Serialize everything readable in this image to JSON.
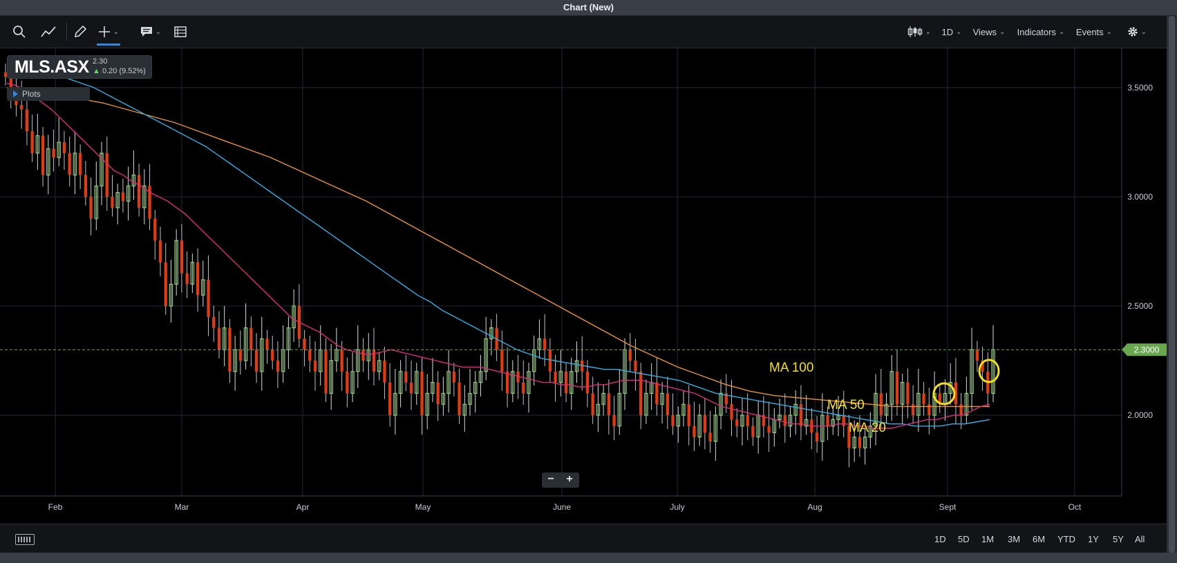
{
  "window": {
    "title": "Chart (New)"
  },
  "toolbar": {
    "interval": "1D",
    "views": "Views",
    "indicators": "Indicators",
    "events": "Events"
  },
  "symbol": {
    "name": "MLS.ASX",
    "price": "2.30",
    "change": "0.20 (9.52%)"
  },
  "plots_label": "Plots",
  "bottom_ranges": [
    "1D",
    "5D",
    "1M",
    "3M",
    "6M",
    "YTD",
    "1Y",
    "5Y",
    "All"
  ],
  "colors": {
    "up": "#8cd66a",
    "down": "#e23b12",
    "ma20": "#e0287f",
    "ma50": "#2bb0e8",
    "ma100": "#f0922c",
    "annotation": "#f5e11a",
    "last_price": "#6aa84f"
  },
  "chart_data": {
    "type": "candlestick",
    "x_ticks": [
      "Feb",
      "Mar",
      "Apr",
      "May",
      "June",
      "July",
      "Aug",
      "Sept",
      "Oct"
    ],
    "y_ticks": [
      "3.5000",
      "3.0000",
      "2.5000",
      "2.0000"
    ],
    "ylim": [
      1.63,
      3.68
    ],
    "last_price_label": "2.3000",
    "last_price": 2.3,
    "grid": true,
    "annotations": [
      "MA 100",
      "MA 50",
      "MA 20"
    ],
    "closes": [
      3.55,
      3.48,
      3.42,
      3.4,
      3.3,
      3.2,
      3.28,
      3.1,
      3.22,
      3.18,
      3.25,
      3.2,
      3.1,
      3.2,
      3.1,
      3.0,
      2.9,
      3.05,
      3.2,
      3.0,
      2.95,
      3.02,
      2.98,
      3.05,
      3.1,
      2.95,
      3.05,
      2.9,
      2.8,
      2.7,
      2.5,
      2.6,
      2.8,
      2.65,
      2.6,
      2.7,
      2.55,
      2.62,
      2.45,
      2.4,
      2.3,
      2.4,
      2.2,
      2.3,
      2.25,
      2.4,
      2.3,
      2.2,
      2.35,
      2.3,
      2.25,
      2.2,
      2.3,
      2.4,
      2.5,
      2.35,
      2.3,
      2.25,
      2.2,
      2.3,
      2.1,
      2.25,
      2.3,
      2.2,
      2.1,
      2.2,
      2.3,
      2.25,
      2.3,
      2.2,
      2.25,
      2.15,
      2.0,
      2.1,
      2.2,
      2.15,
      2.1,
      2.2,
      2.0,
      2.1,
      2.15,
      2.05,
      2.1,
      2.2,
      2.15,
      2.0,
      2.05,
      2.1,
      2.15,
      2.2,
      2.35,
      2.4,
      2.3,
      2.2,
      2.1,
      2.2,
      2.15,
      2.1,
      2.2,
      2.3,
      2.35,
      2.3,
      2.2,
      2.15,
      2.2,
      2.1,
      2.2,
      2.25,
      2.2,
      2.1,
      2.0,
      2.05,
      2.1,
      2.0,
      1.95,
      2.1,
      2.3,
      2.25,
      2.2,
      2.0,
      2.1,
      2.15,
      2.05,
      2.1,
      2.0,
      1.95,
      2.0,
      2.05,
      1.95,
      1.9,
      2.0,
      1.92,
      1.88,
      2.0,
      2.1,
      2.05,
      1.98,
      1.95,
      2.0,
      1.95,
      1.9,
      2.0,
      1.95,
      1.92,
      1.98,
      2.0,
      1.95,
      2.0,
      2.05,
      1.95,
      1.98,
      1.92,
      1.88,
      2.0,
      1.95,
      1.98,
      2.0,
      1.95,
      1.85,
      1.9,
      1.85,
      1.9,
      1.95,
      2.1,
      2.0,
      2.05,
      2.2,
      2.05,
      2.15,
      2.05,
      2.0,
      2.1,
      2.05,
      2.0,
      2.1,
      2.05,
      2.1,
      2.15,
      2.05,
      2.0,
      2.1,
      2.3,
      2.25,
      2.2,
      2.1,
      2.3
    ],
    "ma20": [
      3.52,
      3.51,
      3.49,
      3.46,
      3.43,
      3.4,
      3.36,
      3.32,
      3.28,
      3.24,
      3.2,
      3.16,
      3.12,
      3.1,
      3.07,
      3.05,
      3.02,
      3.0,
      2.98,
      2.95,
      2.92,
      2.88,
      2.84,
      2.8,
      2.76,
      2.72,
      2.68,
      2.64,
      2.6,
      2.56,
      2.52,
      2.48,
      2.44,
      2.42,
      2.4,
      2.38,
      2.35,
      2.32,
      2.3,
      2.29,
      2.28,
      2.28,
      2.29,
      2.3,
      2.29,
      2.28,
      2.27,
      2.26,
      2.25,
      2.24,
      2.23,
      2.22,
      2.22,
      2.22,
      2.21,
      2.2,
      2.19,
      2.18,
      2.17,
      2.16,
      2.15,
      2.15,
      2.14,
      2.14,
      2.13,
      2.13,
      2.14,
      2.14,
      2.15,
      2.16,
      2.16,
      2.16,
      2.15,
      2.14,
      2.13,
      2.12,
      2.11,
      2.1,
      2.08,
      2.06,
      2.04,
      2.03,
      2.02,
      2.01,
      2.0,
      1.99,
      1.98,
      1.97,
      1.96,
      1.96,
      1.95,
      1.95,
      1.95,
      1.96,
      1.96,
      1.95,
      1.95,
      1.94,
      1.94,
      1.94,
      1.95,
      1.96,
      1.97,
      1.98,
      1.98,
      1.99,
      2.0,
      2.0,
      2.02,
      2.04,
      2.05
    ],
    "ma50": [
      3.62,
      3.61,
      3.6,
      3.58,
      3.56,
      3.54,
      3.52,
      3.5,
      3.47,
      3.44,
      3.41,
      3.38,
      3.35,
      3.32,
      3.29,
      3.26,
      3.23,
      3.19,
      3.15,
      3.11,
      3.07,
      3.03,
      2.99,
      2.95,
      2.91,
      2.87,
      2.83,
      2.79,
      2.75,
      2.71,
      2.67,
      2.63,
      2.59,
      2.55,
      2.52,
      2.48,
      2.45,
      2.42,
      2.39,
      2.36,
      2.33,
      2.3,
      2.28,
      2.26,
      2.25,
      2.24,
      2.23,
      2.22,
      2.21,
      2.21,
      2.2,
      2.19,
      2.18,
      2.17,
      2.16,
      2.14,
      2.12,
      2.1,
      2.09,
      2.08,
      2.07,
      2.06,
      2.05,
      2.04,
      2.03,
      2.02,
      2.01,
      2.0,
      1.99,
      1.98,
      1.97,
      1.96,
      1.96,
      1.95,
      1.95,
      1.95,
      1.96,
      1.96,
      1.97,
      1.98
    ],
    "ma100": [
      3.5,
      3.49,
      3.47,
      3.45,
      3.43,
      3.4,
      3.37,
      3.34,
      3.3,
      3.26,
      3.22,
      3.18,
      3.13,
      3.08,
      3.03,
      2.98,
      2.92,
      2.86,
      2.8,
      2.74,
      2.68,
      2.62,
      2.56,
      2.5,
      2.44,
      2.38,
      2.32,
      2.27,
      2.22,
      2.18,
      2.14,
      2.11,
      2.09,
      2.08,
      2.07,
      2.06,
      2.05,
      2.04,
      2.04,
      2.04,
      2.04,
      2.04
    ]
  }
}
